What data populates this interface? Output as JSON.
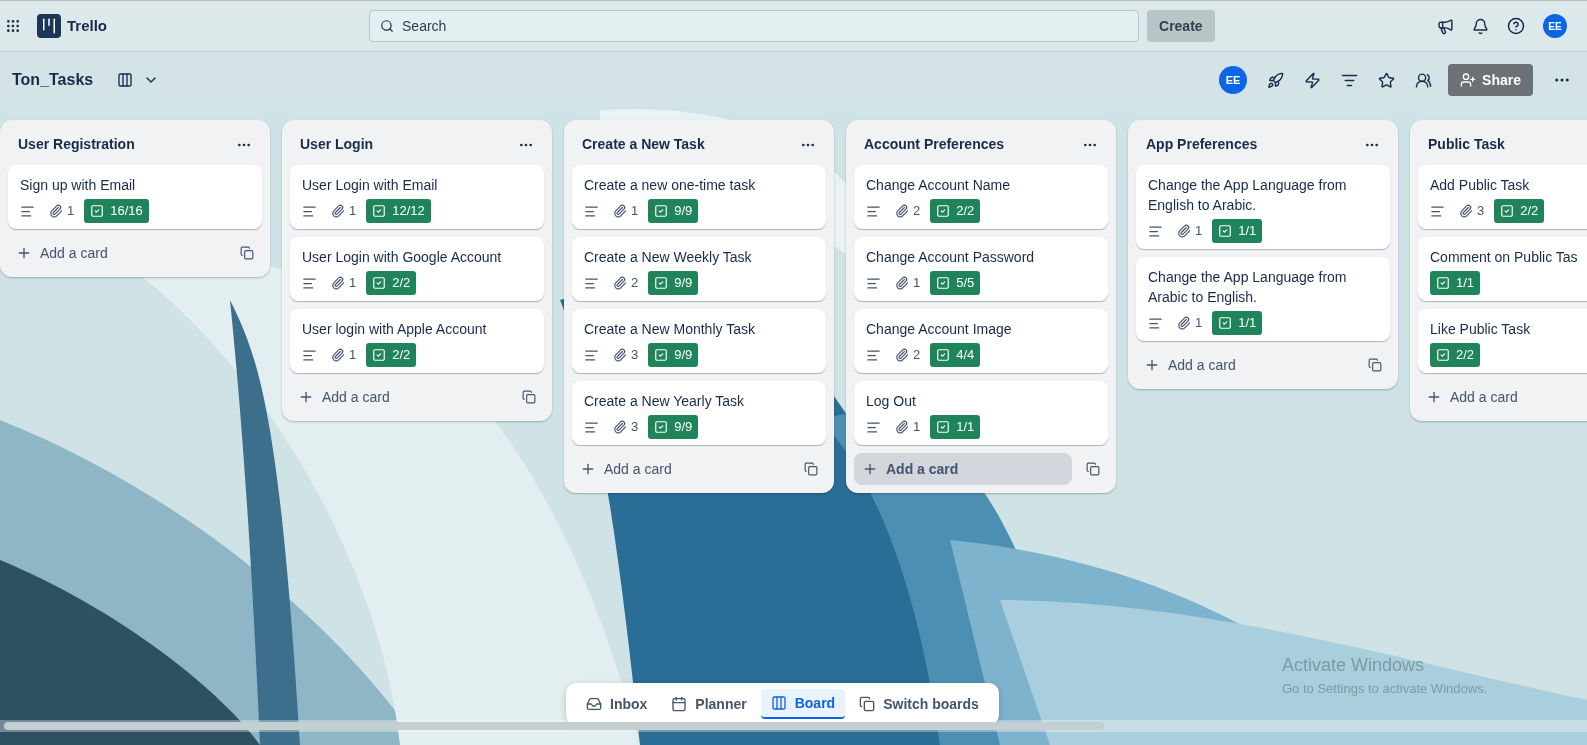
{
  "topbar": {
    "app_name": "Trello",
    "search": {
      "placeholder": "Search"
    },
    "create_button": "Create",
    "avatar": "EE"
  },
  "board_header": {
    "title": "Ton_Tasks",
    "avatar": "EE",
    "share_button": "Share"
  },
  "lists": [
    {
      "title": "User Registration",
      "add_card": "Add a card",
      "add_card_highlighted": false,
      "cards": [
        {
          "title": "Sign up with Email",
          "description": true,
          "attachments": "1",
          "checklist": "16/16"
        }
      ]
    },
    {
      "title": "User Login",
      "add_card": "Add a card",
      "add_card_highlighted": false,
      "cards": [
        {
          "title": "User Login with Email",
          "description": true,
          "attachments": "1",
          "checklist": "12/12"
        },
        {
          "title": "User Login with Google Account",
          "description": true,
          "attachments": "1",
          "checklist": "2/2"
        },
        {
          "title": "User login with Apple Account",
          "description": true,
          "attachments": "1",
          "checklist": "2/2"
        }
      ]
    },
    {
      "title": "Create a New Task",
      "add_card": "Add a card",
      "add_card_highlighted": false,
      "cards": [
        {
          "title": "Create a new one-time task",
          "description": true,
          "attachments": "1",
          "checklist": "9/9"
        },
        {
          "title": "Create a New Weekly Task",
          "description": true,
          "attachments": "2",
          "checklist": "9/9"
        },
        {
          "title": "Create a New Monthly Task",
          "description": true,
          "attachments": "3",
          "checklist": "9/9"
        },
        {
          "title": "Create a New Yearly Task",
          "description": true,
          "attachments": "3",
          "checklist": "9/9"
        }
      ]
    },
    {
      "title": "Account Preferences",
      "add_card": "Add a card",
      "add_card_highlighted": true,
      "cards": [
        {
          "title": "Change Account Name",
          "description": true,
          "attachments": "2",
          "checklist": "2/2"
        },
        {
          "title": "Change Account Password",
          "description": true,
          "attachments": "1",
          "checklist": "5/5"
        },
        {
          "title": "Change Account Image",
          "description": true,
          "attachments": "2",
          "checklist": "4/4"
        },
        {
          "title": "Log Out",
          "description": true,
          "attachments": "1",
          "checklist": "1/1"
        }
      ]
    },
    {
      "title": "App Preferences",
      "add_card": "Add a card",
      "add_card_highlighted": false,
      "cards": [
        {
          "title": "Change the App Language from English to Arabic.",
          "description": true,
          "attachments": "1",
          "checklist": "1/1"
        },
        {
          "title": "Change the App Language from Arabic to English.",
          "description": true,
          "attachments": "1",
          "checklist": "1/1"
        }
      ]
    },
    {
      "title": "Public Task",
      "add_card": "Add a card",
      "add_card_highlighted": false,
      "cards": [
        {
          "title": "Add Public Task",
          "description": true,
          "attachments": "3",
          "checklist": "2/2"
        },
        {
          "title": "Comment on Public Tas",
          "description": false,
          "checklist": "1/1"
        },
        {
          "title": "Like Public Task",
          "description": false,
          "checklist": "2/2"
        }
      ]
    }
  ],
  "bottom_nav": [
    {
      "label": "Inbox",
      "kind": "inbox",
      "selected": false
    },
    {
      "label": "Planner",
      "kind": "planner",
      "selected": false
    },
    {
      "label": "Board",
      "kind": "board",
      "selected": true
    },
    {
      "label": "Switch boards",
      "kind": "switch",
      "selected": false
    }
  ],
  "os_notice": {
    "title": "Activate Windows",
    "text": "Go to Settings to activate Windows."
  }
}
